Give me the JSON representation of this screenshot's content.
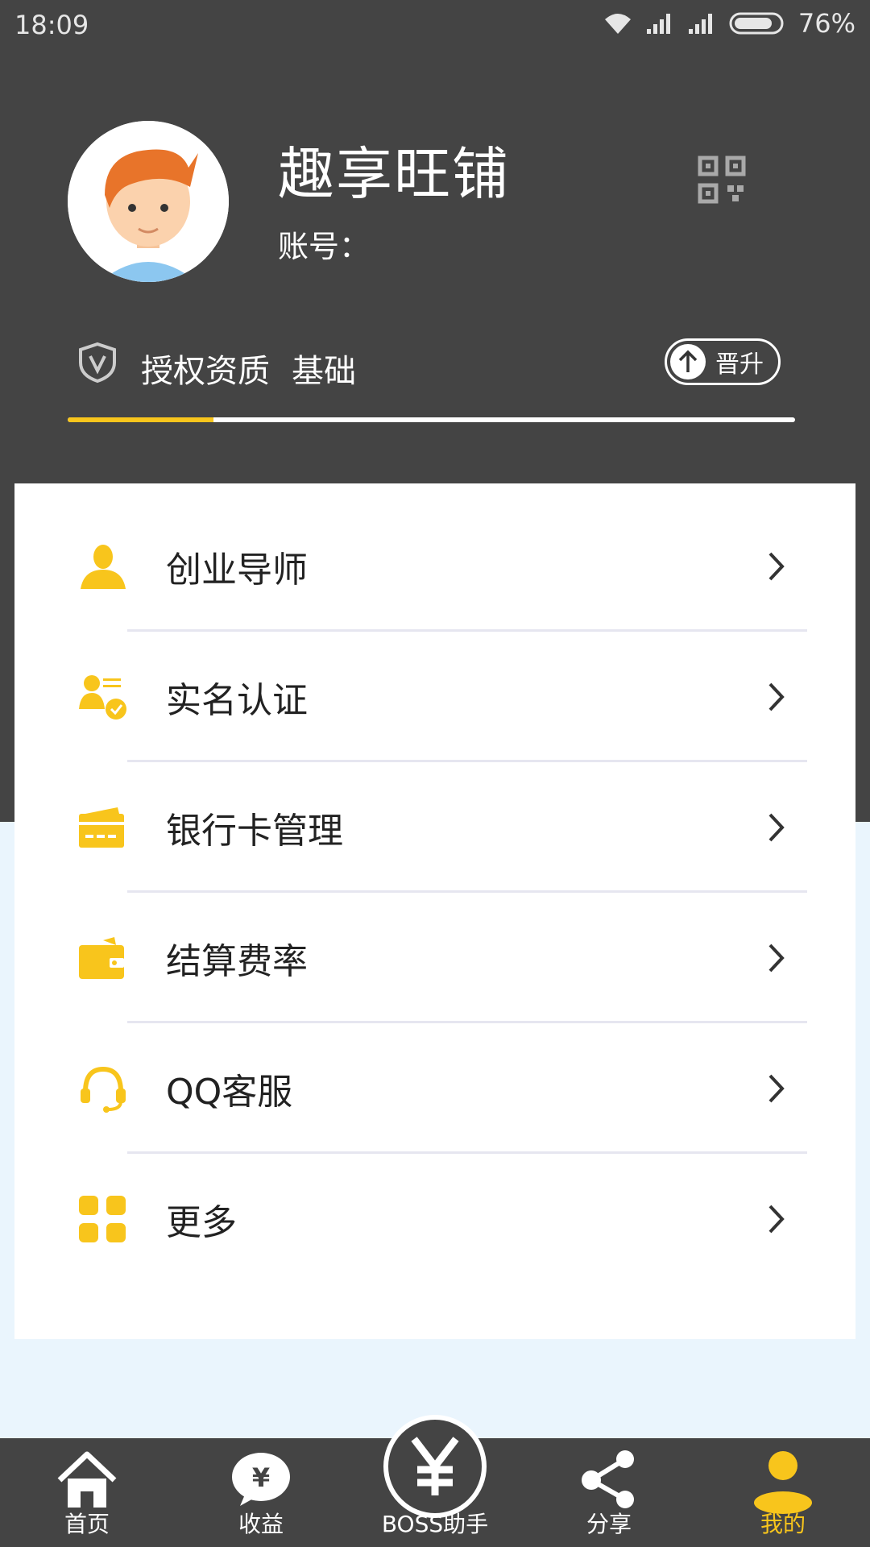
{
  "status": {
    "time": "18:09",
    "battery": "76%"
  },
  "profile": {
    "name": "趣享旺铺",
    "account_label": "账号："
  },
  "auth": {
    "label": "授权资质",
    "level": "基础",
    "upgrade_label": "晋升",
    "progress": 0.2
  },
  "menu": [
    {
      "label": "创业导师",
      "icon": "mentor-icon"
    },
    {
      "label": "实名认证",
      "icon": "id-verify-icon"
    },
    {
      "label": "银行卡管理",
      "icon": "bank-card-icon"
    },
    {
      "label": "结算费率",
      "icon": "wallet-icon"
    },
    {
      "label": "QQ客服",
      "icon": "headset-icon"
    },
    {
      "label": "更多",
      "icon": "grid-icon"
    }
  ],
  "tabs": [
    {
      "label": "首页",
      "icon": "home-icon"
    },
    {
      "label": "收益",
      "icon": "earnings-icon"
    },
    {
      "label": "BOSS助手",
      "icon": "yen-icon"
    },
    {
      "label": "分享",
      "icon": "share-icon"
    },
    {
      "label": "我的",
      "icon": "user-icon",
      "active": true
    }
  ],
  "colors": {
    "accent": "#f8c51c",
    "header": "#444444",
    "page_bg": "#eaf5fd"
  }
}
